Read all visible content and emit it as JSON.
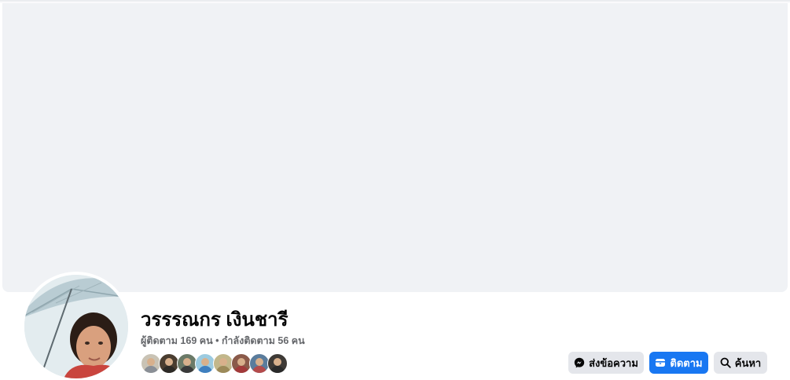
{
  "profile": {
    "name": "วรรรณกร เงินชารี",
    "stats": "ผู้ติดตาม 169 คน • กำลังติดตาม 56 คน"
  },
  "friends": [
    {
      "shirt": "#8a8f96",
      "bg": "#c9c3b5"
    },
    {
      "shirt": "#2d2a26",
      "bg": "#4a3d30"
    },
    {
      "shirt": "#3a3a3a",
      "bg": "#6b7a68"
    },
    {
      "shirt": "#3f7fbf",
      "bg": "#9ccbe0"
    },
    {
      "shirt": "#9c8a5a",
      "bg": "#c2b78b"
    },
    {
      "shirt": "#a23a3a",
      "bg": "#8a5a4a"
    },
    {
      "shirt": "#b44b4b",
      "bg": "#5a7c9c"
    },
    {
      "shirt": "#2a2a2a",
      "bg": "#3e3a36"
    }
  ],
  "actions": {
    "message_label": "ส่งข้อความ",
    "follow_label": "ติดตาม",
    "search_label": "ค้นหา"
  },
  "colors": {
    "cover": "#f0f2f5",
    "primary": "#1877f2",
    "secondary_button": "#e4e6eb",
    "muted_text": "#65676b"
  },
  "icons": {
    "message": "messenger-icon",
    "follow": "follow-icon",
    "search": "search-icon"
  }
}
